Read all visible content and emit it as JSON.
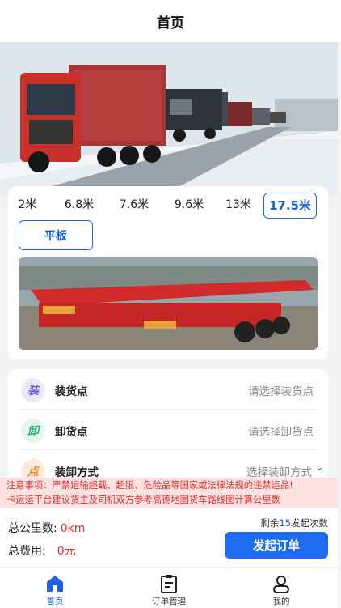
{
  "header": {
    "title": "首页"
  },
  "vehicle": {
    "lengths": [
      "2米",
      "6.8米",
      "7.6米",
      "9.6米",
      "13米",
      "17.5米"
    ],
    "selected_length": "17.5米",
    "type_label": "平板"
  },
  "form": {
    "load": {
      "badge": "装",
      "label": "装货点",
      "placeholder": "请选择装货点"
    },
    "unload": {
      "badge": "卸",
      "label": "卸货点",
      "placeholder": "请选择卸货点"
    },
    "method": {
      "badge": "点",
      "label": "装卸方式",
      "placeholder": "选择装卸方式"
    }
  },
  "notice": {
    "line1": "注意事项：严禁运输超载、超限、危险品等国家或法律法规的违禁运品!",
    "line2": "卡运运平台建议货主及司机双方参考高德地图货车路线图计算公里数"
  },
  "summary": {
    "distance_label": "总公里数:",
    "distance_value": "0km",
    "cost_label": "总费用:",
    "cost_value": "0元",
    "remaining_prefix": "剩余",
    "remaining_count": "15",
    "remaining_suffix": "发起次数",
    "submit_label": "发起订单"
  },
  "tabs": [
    {
      "label": "首页",
      "icon": "home-icon"
    },
    {
      "label": "订单管理",
      "icon": "clipboard-icon"
    },
    {
      "label": "我的",
      "icon": "user-icon"
    }
  ],
  "colors": {
    "accent": "#1f63e0",
    "alert": "#e02f2f",
    "alert_bg": "#fde2e2"
  }
}
